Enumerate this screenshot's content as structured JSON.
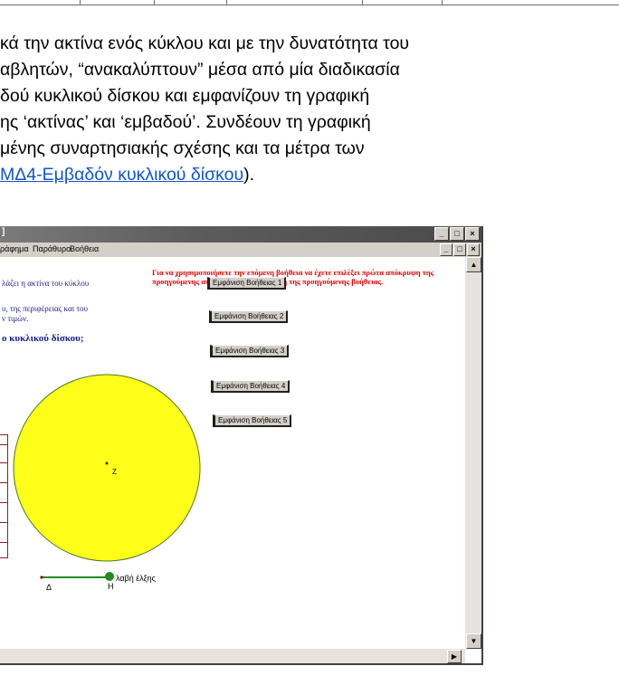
{
  "document": {
    "lines": [
      "κά την ακτίνα ενός κύκλου και με την δυνατότητα του",
      "αβλητών, “ανακαλύπτουν” μέσα από μία διαδικασία",
      "δού κυκλικού δίσκου και εμφανίζουν τη γραφική",
      "ης ‘ακτίνας’ και ‘εμβαδού’. Συνδέουν τη γραφική",
      "μένης συναρτησιακής σχέσης και τα μέτρα των"
    ],
    "last_line_link": "ΜΔ4-Εμβαδόν κυκλικού δίσκου",
    "last_line_suffix": ")."
  },
  "app": {
    "title": "]",
    "menu": [
      "ράφημα",
      "Παράθυρο",
      "Βοήθεια"
    ],
    "window_buttons": [
      "_",
      "□",
      "×"
    ],
    "mdi_buttons": [
      "_",
      "□",
      "×"
    ],
    "left_text_1": "λάζει η ακτίνα του κύκλου",
    "left_text_2": "υ, της περιφέρειας και του",
    "left_text_3": "ν τιμών.",
    "left_question": "ο κυκλικού δίσκου;",
    "red_note": "Για να χρησιμοποιήσετε την επόμενη βοήθεια να έχετε επιλέξει πρώτα απόκρυψη της προηγούμενης απάντησης και απόκρυψη της προηγούμενης βοήθειας.",
    "help_buttons": [
      "Εμφάνιση Βοήθειας 1",
      "Εμφάνιση Βοήθειας 2",
      "Εμφάνιση Βοήθειας 3",
      "Εμφάνιση Βοήθειας 4",
      "Εμφάνιση Βοήθειας 5"
    ],
    "center_label": "Z",
    "slider_start_label": "Δ",
    "slider_end_label": "Η",
    "slider_handle_label": "λαβή έλξης",
    "colors": {
      "disc_fill": "#ffff1a",
      "disc_stroke": "#4a7a20",
      "slider_line": "#228b22",
      "note_red": "#e00000",
      "text_navy": "#1a1a8a"
    }
  }
}
